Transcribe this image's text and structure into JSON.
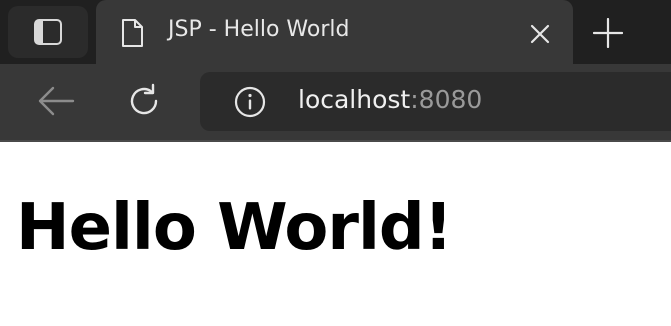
{
  "tab_strip": {
    "tab_actions_icon": "tab-actions-icon",
    "active_tab": {
      "icon": "page-icon",
      "title": "JSP - Hello World",
      "close_icon": "close-icon"
    },
    "new_tab_icon": "plus-icon"
  },
  "toolbar": {
    "back_icon": "back-arrow-icon",
    "refresh_icon": "refresh-icon",
    "address": {
      "info_icon": "info-icon",
      "host": "localhost",
      "port": ":8080"
    }
  },
  "page": {
    "heading": "Hello World!"
  },
  "colors": {
    "tab_strip_bg": "#202020",
    "active_tab_bg": "#383838",
    "address_bar_bg": "#2b2b2b",
    "icon_color": "#e6e6e6",
    "port_color": "#9a9a9a",
    "page_bg": "#ffffff"
  }
}
